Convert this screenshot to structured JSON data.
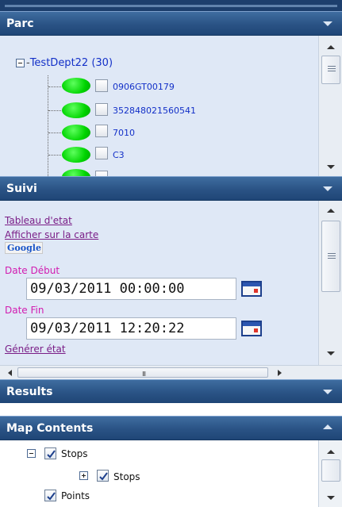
{
  "parc": {
    "title": "Parc",
    "root_label": "TestDept22 (30)",
    "items": [
      {
        "label": "0906GT00179"
      },
      {
        "label": "352848021560541"
      },
      {
        "label": "7010"
      },
      {
        "label": "C3"
      }
    ],
    "status_color": "#00d400"
  },
  "suivi": {
    "title": "Suivi",
    "tableau_link": "Tableau d'etat",
    "carte_link": "Afficher sur la carte",
    "google_badge": "Google",
    "date_debut_label": "Date Début",
    "date_debut_value": "09/03/2011 00:00:00",
    "date_fin_label": "Date Fin",
    "date_fin_value": "09/03/2011 12:20:22",
    "generer_link": "Générer état",
    "hscroll_grip": "III"
  },
  "results": {
    "title": "Results"
  },
  "map_contents": {
    "title": "Map Contents",
    "layers": [
      {
        "label": "Stops",
        "checked": true
      },
      {
        "label": "Stops",
        "checked": true
      },
      {
        "label": "Points",
        "checked": true
      }
    ]
  },
  "colors": {
    "header": "#2a5385",
    "panel_bg": "#dfe8f6",
    "link": "#7a1d87",
    "date_label": "#d21bb0",
    "tree_text": "#1330c8"
  },
  "icons": [
    "collapse-arrow-icon",
    "calendar-icon",
    "status-dot-icon",
    "checkbox-icon",
    "tree-expand-icon",
    "tree-collapse-icon"
  ]
}
